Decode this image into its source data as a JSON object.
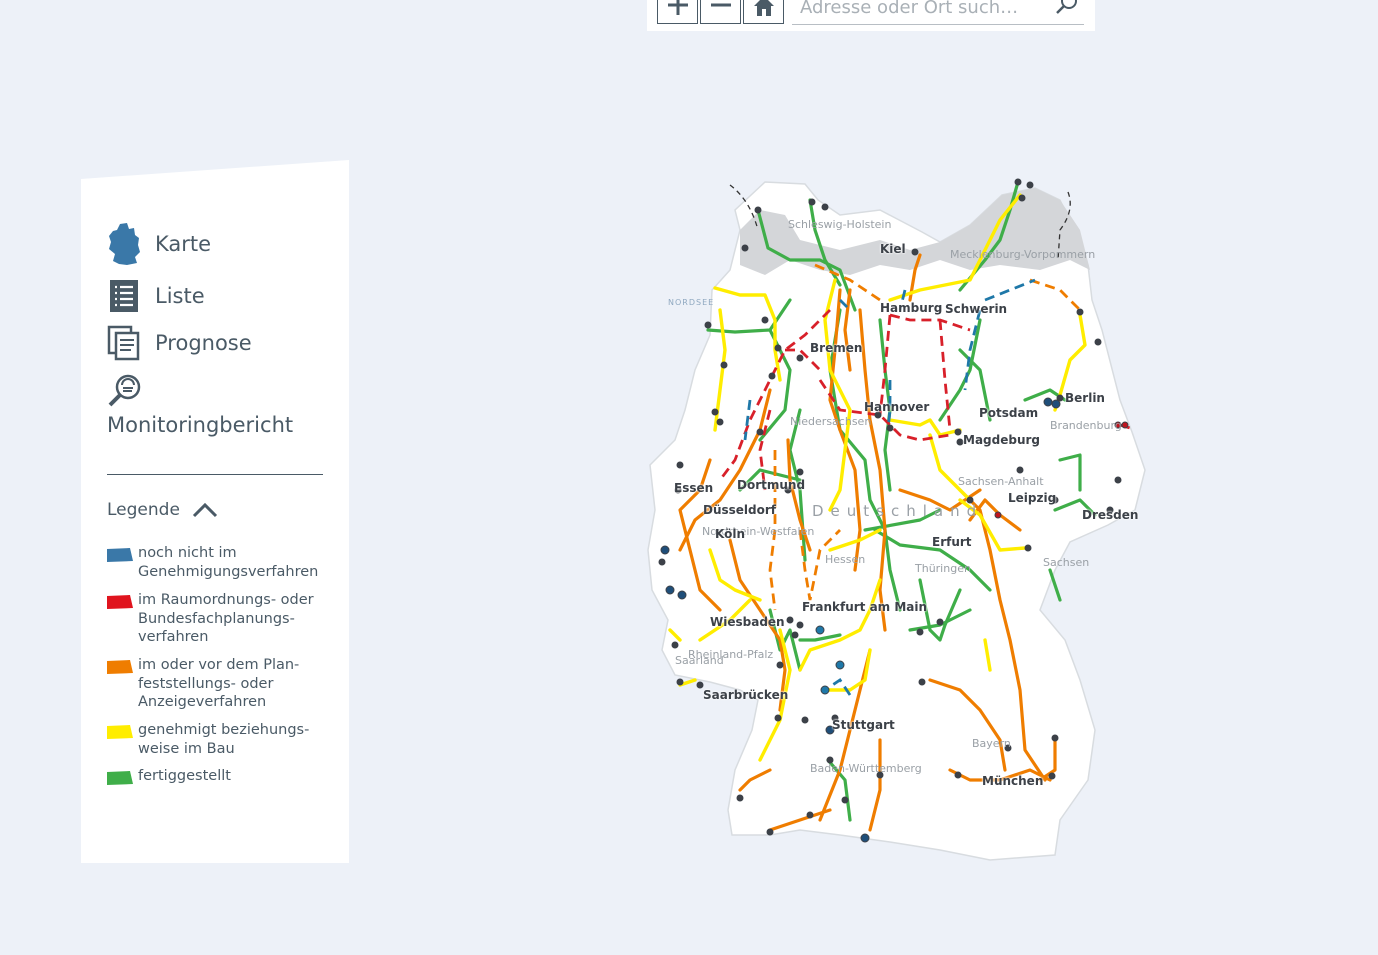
{
  "toolbar": {
    "search_placeholder": "Adresse oder Ort such…"
  },
  "nav": {
    "karte": "Karte",
    "liste": "Liste",
    "prognose": "Prognose",
    "monitoringbericht": "Monitoringbericht"
  },
  "legend": {
    "title": "Legende",
    "items": [
      {
        "label": "noch nicht im Genehmigungsverfahren",
        "color": "#3a78a8"
      },
      {
        "label": "im Raumordnungs- oder Bundesfachplanungs-verfahren",
        "color": "#e0141e"
      },
      {
        "label": "im oder vor dem Plan-feststellungs- oder Anzeigeverfahren",
        "color": "#ef7d00"
      },
      {
        "label": "genehmigt beziehungs-weise im Bau",
        "color": "#ffed00"
      },
      {
        "label": "fertiggestellt",
        "color": "#3fae49"
      }
    ]
  },
  "map": {
    "country": "Deutschland",
    "sea": "NORDSEE",
    "cities": [
      "Kiel",
      "Hamburg",
      "Schwerin",
      "Bremen",
      "Hannover",
      "Berlin",
      "Potsdam",
      "Magdeburg",
      "Dortmund",
      "Essen",
      "Düsseldorf",
      "Köln",
      "Leipzig",
      "Dresden",
      "Erfurt",
      "Wiesbaden",
      "Frankfurt am Main",
      "Saarbrücken",
      "Stuttgart",
      "München"
    ],
    "regions": [
      "Schleswig-Holstein",
      "Mecklenburg-Vorpommern",
      "Niedersachsen",
      "Brandenburg",
      "Sachsen-Anhalt",
      "Nordrhein-Westfalen",
      "Hessen",
      "Thüringen",
      "Sachsen",
      "Rheinland-Pfalz",
      "Saarland",
      "Baden-Württemberg",
      "Bayern"
    ]
  }
}
